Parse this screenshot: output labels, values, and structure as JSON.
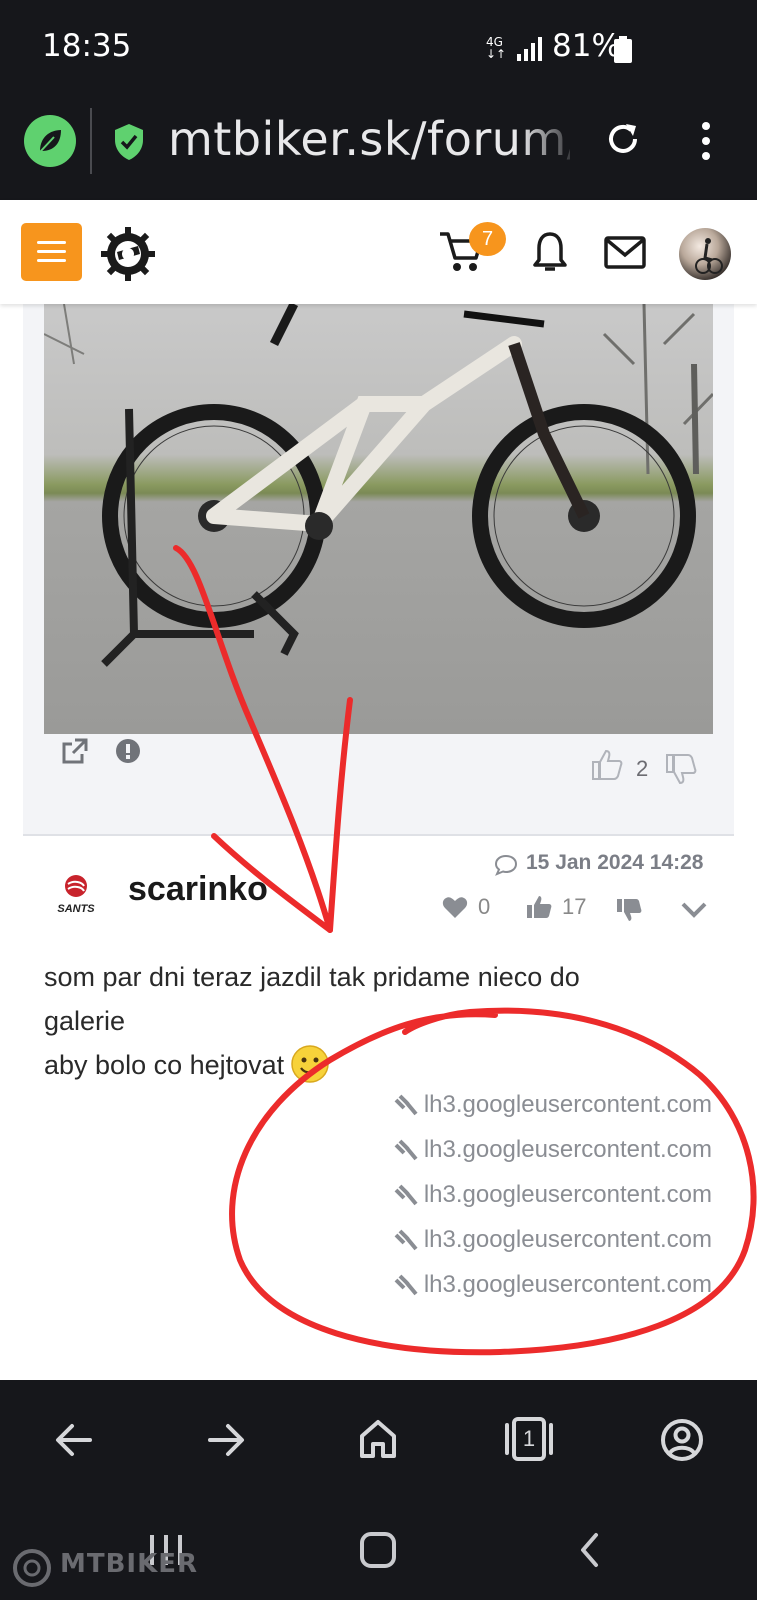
{
  "status_bar": {
    "time": "18:35",
    "network": "4G",
    "battery": "81%"
  },
  "browser": {
    "url": "mtbiker.sk/forum/p"
  },
  "site_header": {
    "cart_count": "7"
  },
  "previous_post": {
    "rating": "2"
  },
  "post": {
    "date": "15 Jan 2024 14:28",
    "username": "scarinko",
    "logo_text": "SANTS",
    "likes": "0",
    "thumbs_up": "17",
    "body_lines": [
      "som par dni teraz jazdil tak pridame nieco do",
      "galerie",
      "aby bolo co hejtovat"
    ],
    "links": [
      "lh3.googleusercontent.com",
      "lh3.googleusercontent.com",
      "lh3.googleusercontent.com",
      "lh3.googleusercontent.com",
      "lh3.googleusercontent.com"
    ]
  },
  "bottom_nav": {
    "tabs_count": "1"
  },
  "watermark": "MTBIKER",
  "colors": {
    "accent": "#f7951d",
    "annotation_red": "#ec2b2b",
    "dark_bar": "#16171b",
    "leaf_green": "#5fd16f"
  }
}
